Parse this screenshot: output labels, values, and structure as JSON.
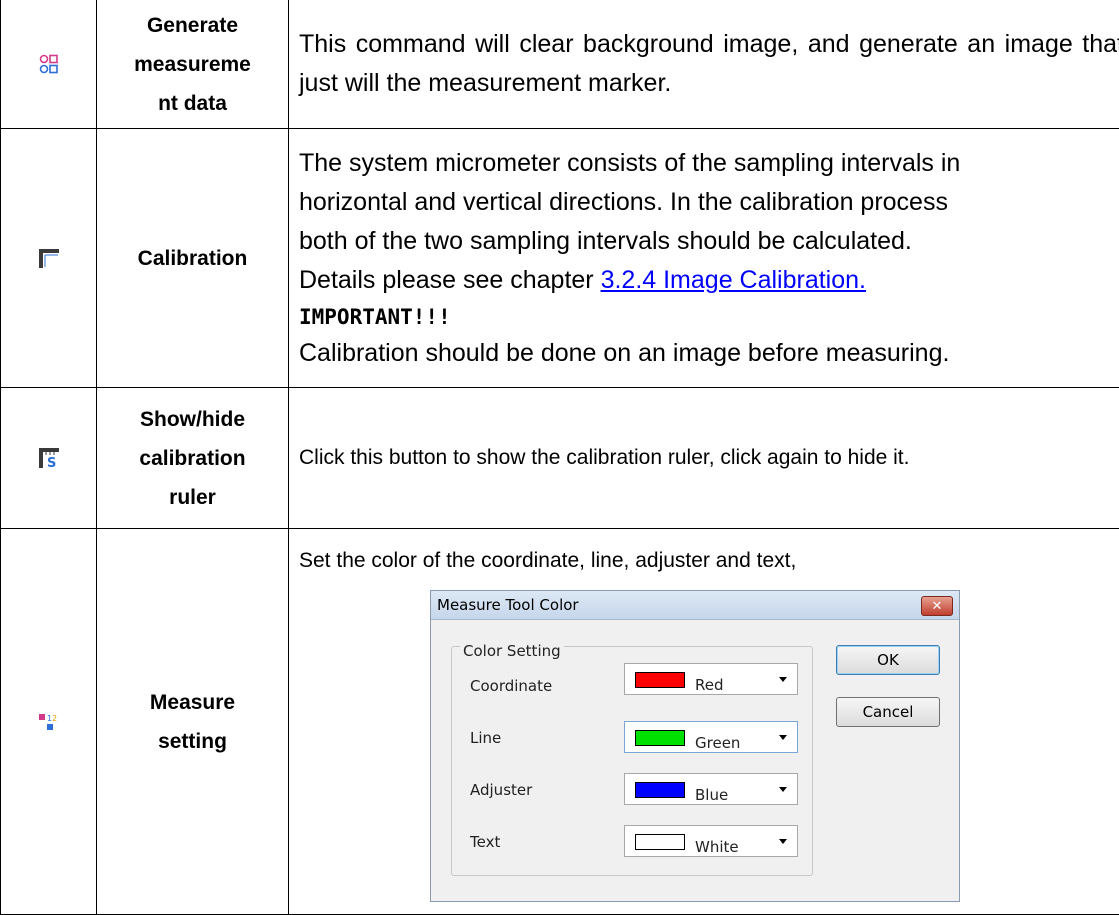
{
  "rows": [
    {
      "icon": "measure-data-icon",
      "name_lines": [
        "Generate",
        "measureme",
        "nt data"
      ],
      "desc": "This command will clear background image, and generate an image that just will the measurement marker."
    },
    {
      "icon": "calibration-icon",
      "name": "Calibration",
      "desc_lines": [
        "The system micrometer consists of the sampling intervals in",
        "horizontal and vertical directions. In the calibration process",
        "both of the two sampling intervals should be calculated."
      ],
      "details_prefix": "Details please see chapter ",
      "details_link": "3.2.4 Image Calibration.",
      "important": "IMPORTANT!!!",
      "note": "Calibration should be done on an image before measuring."
    },
    {
      "icon": "ruler-icon",
      "name_lines": [
        "Show/hide",
        "calibration",
        "ruler"
      ],
      "desc": "Click this button to show the calibration ruler, click again to hide it."
    },
    {
      "icon": "measure-setting-icon",
      "name_lines": [
        "Measure",
        "setting"
      ],
      "desc": "Set the color of the coordinate, line, adjuster and text,"
    }
  ],
  "dialog": {
    "title": "Measure Tool Color",
    "close": "✕",
    "group_label": "Color Setting",
    "items": [
      {
        "label": "Coordinate",
        "value": "Red",
        "color": "#ff0000"
      },
      {
        "label": "Line",
        "value": "Green",
        "color": "#00e000"
      },
      {
        "label": "Adjuster",
        "value": "Blue",
        "color": "#0000ff"
      },
      {
        "label": "Text",
        "value": "White",
        "color": "#ffffff"
      }
    ],
    "ok": "OK",
    "cancel": "Cancel"
  }
}
